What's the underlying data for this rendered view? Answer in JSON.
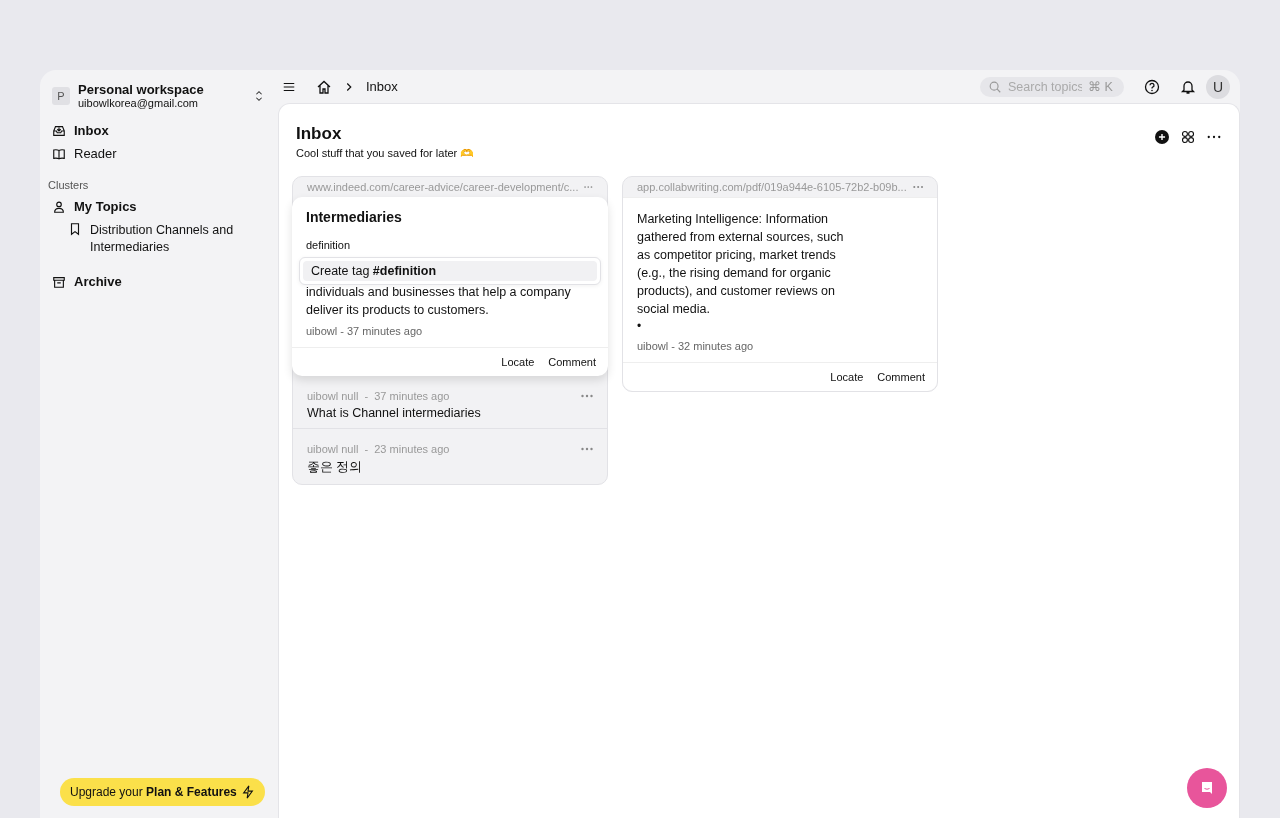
{
  "workspace": {
    "avatar": "P",
    "name": "Personal workspace",
    "email": "uibowlkorea@gmail.com"
  },
  "nav": [
    {
      "label": "Inbox",
      "selected": true
    },
    {
      "label": "Reader",
      "selected": false
    }
  ],
  "clusters": {
    "heading": "Clusters",
    "groups": [
      {
        "label": "My Topics",
        "children": [
          {
            "label": "Distribution Channels and Intermediaries"
          }
        ]
      }
    ]
  },
  "archive": {
    "label": "Archive"
  },
  "upgrade": "Upgrade your **Plan & Features**",
  "topbar": {
    "breadcrumb": "Inbox",
    "search_placeholder": "Search topics",
    "shortcut": "⌘ K",
    "avatar": "U"
  },
  "page": {
    "title": "Inbox",
    "subtitle": "Cool stuff that you saved for later 🫶"
  },
  "cards": [
    {
      "url": "www.indeed.com/career-advice/career-development/c...",
      "title": "Intermediaries",
      "input": "definition",
      "suggestion": "Create tag **#definition**",
      "body": "individuals and businesses that help a company deliver its products to customers.",
      "meta": "uibowl - 37 minutes ago",
      "actions": [
        "Locate",
        "Comment"
      ],
      "replies": [
        {
          "meta": "uibowl null  -  37 minutes ago",
          "text": "What is Channel intermediaries"
        },
        {
          "meta": "uibowl null  -  23 minutes ago",
          "text": "좋은 정의"
        }
      ]
    },
    {
      "url": "app.collabwriting.com/pdf/019a944e-6105-72b2-b09b...",
      "body": "Marketing Intelligence: Information gathered from external sources, such as competitor pricing, market trends (e.g., the rising demand for organic products), and customer reviews on social media.",
      "bullet": "•",
      "meta": "uibowl - 32 minutes ago",
      "actions": [
        "Locate",
        "Comment"
      ]
    }
  ]
}
